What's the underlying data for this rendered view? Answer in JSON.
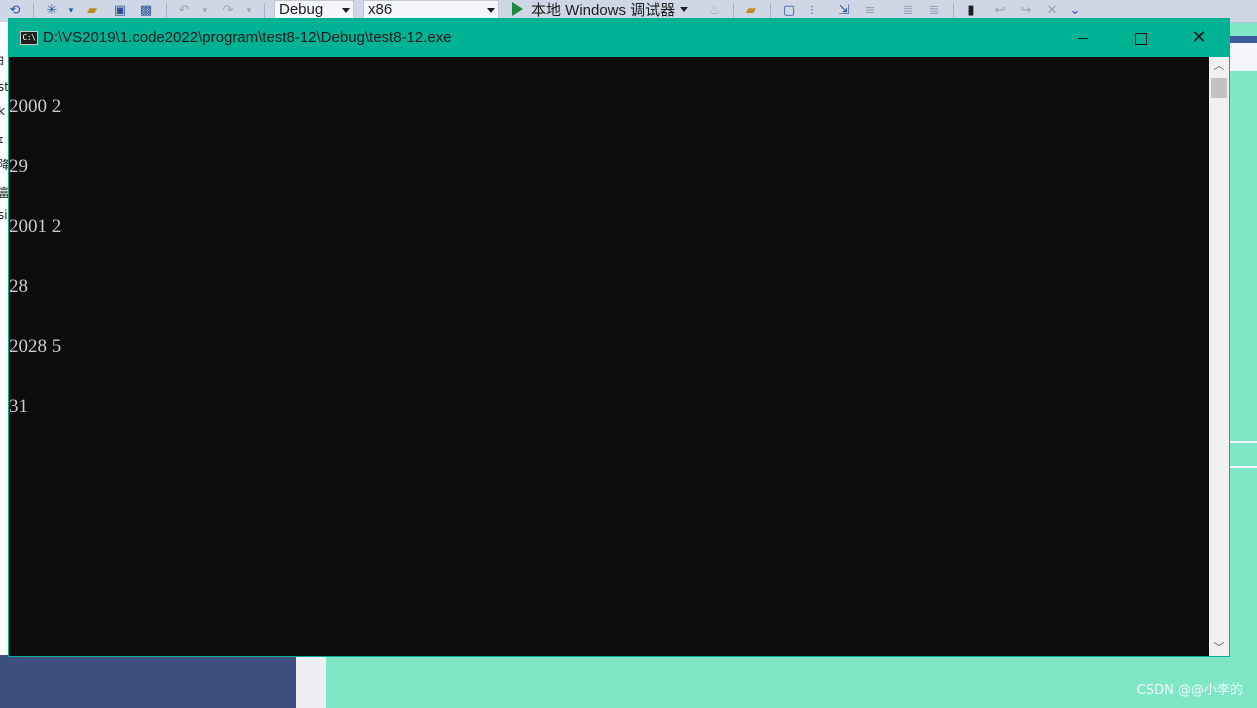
{
  "toolbar": {
    "config_combo": "Debug",
    "platform_combo": "x86",
    "run_label": "本地 Windows 调试器"
  },
  "left_strip": [
    "ﾖ",
    "st",
    "k",
    "ｪ",
    "降",
    "富",
    "si"
  ],
  "console": {
    "title": "D:\\VS2019\\1.code2022\\program\\test8-12\\Debug\\test8-12.exe",
    "icon_text": "C:\\",
    "lines": [
      "2000 2",
      "29",
      "2001 2",
      "28",
      "2028 5",
      "31"
    ]
  },
  "watermark": "CSDN @@小李的",
  "colors": {
    "titlebar": "#00b294",
    "console_bg": "#0c0c0c",
    "console_text": "#cccccc",
    "background": "#7fe6c6"
  }
}
